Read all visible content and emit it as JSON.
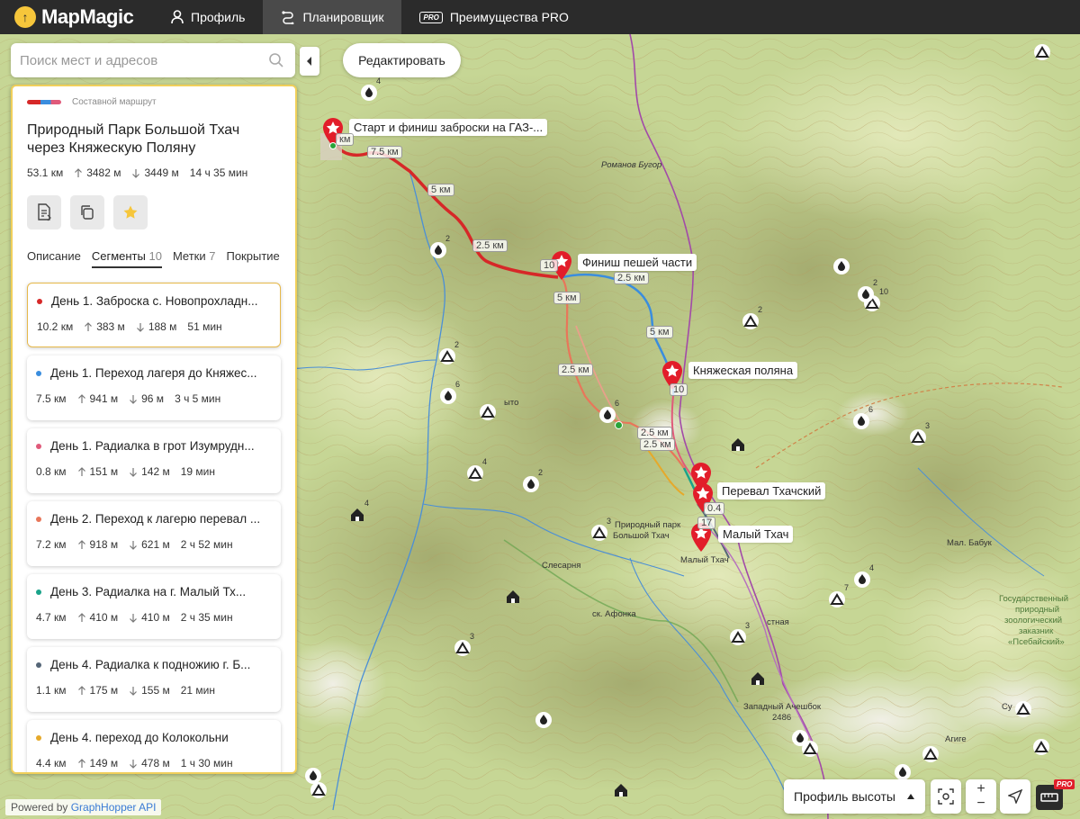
{
  "brand": {
    "name": "MapMagic",
    "mark": "↑"
  },
  "nav": [
    {
      "label": "Профиль",
      "icon": "user-icon"
    },
    {
      "label": "Планировщик",
      "icon": "route-icon"
    },
    {
      "label": "Преимущества PRO",
      "icon": "pro-icon",
      "chip": "PRO"
    }
  ],
  "search": {
    "placeholder": "Поиск мест и адресов",
    "value": ""
  },
  "edit_button": "Редактировать",
  "route": {
    "type_label": "Составной маршрут",
    "title": "Природный Парк Большой Тхач через Княжескую Поляну",
    "distance": "53.1 км",
    "ascent": "3482 м",
    "descent": "3449 м",
    "duration": "14 ч 35 мин"
  },
  "tabs": [
    {
      "label": "Описание",
      "count": ""
    },
    {
      "label": "Сегменты",
      "count": "10"
    },
    {
      "label": "Метки",
      "count": "7"
    },
    {
      "label": "Покрытие",
      "count": ""
    }
  ],
  "segments": [
    {
      "title": "День 1. Заброска с. Новопрохладн...",
      "color": "#d62828",
      "distance": "10.2 км",
      "ascent": "383 м",
      "descent": "188 м",
      "duration": "51 мин"
    },
    {
      "title": "День 1. Переход лагеря до Княжес...",
      "color": "#3a8dde",
      "distance": "7.5 км",
      "ascent": "941 м",
      "descent": "96 м",
      "duration": "3 ч 5 мин"
    },
    {
      "title": "День 1. Радиалка в грот Изумрудн...",
      "color": "#e05a7a",
      "distance": "0.8 км",
      "ascent": "151 м",
      "descent": "142 м",
      "duration": "19 мин"
    },
    {
      "title": "День 2. Переход к лагерю перевал ...",
      "color": "#e8765a",
      "distance": "7.2 км",
      "ascent": "918 м",
      "descent": "621 м",
      "duration": "2 ч 52 мин"
    },
    {
      "title": "День 3. Радиалка на г. Малый Тх...",
      "color": "#1aa38a",
      "distance": "4.7 км",
      "ascent": "410 м",
      "descent": "410 м",
      "duration": "2 ч 35 мин"
    },
    {
      "title": "День 4. Радиалка к подножию г. Б...",
      "color": "#556677",
      "distance": "1.1 км",
      "ascent": "175 м",
      "descent": "155 м",
      "duration": "21 мин"
    },
    {
      "title": "День 4. переход до Колокольни",
      "color": "#e6a92a",
      "distance": "4.4 км",
      "ascent": "149 м",
      "descent": "478 м",
      "duration": "1 ч 30 мин"
    }
  ],
  "map_labels": {
    "start": "Старт и финиш заброски на ГАЗ-...",
    "finish_walk": "Финиш пешей части",
    "knyazheskaya": "Княжеская поляна",
    "pereval": "Перевал Тхачский",
    "maly_tkhach": "Малый Тхач"
  },
  "places": {
    "romanov": "Романов Бугор",
    "park_1": "Природный парк",
    "park_2": "Большой Тхач",
    "slesarnya": "Слесарня",
    "afonka": "ск. Афонка",
    "malyi_tkhach_small": "Малый Тхач",
    "mal_babuk": "Мал. Бабук",
    "zap_acheshbok_1": "Западный Ачешбок",
    "zap_acheshbok_2": "2486",
    "zapovednik_1": "Государственный",
    "zapovednik_2": "природный",
    "zapovednik_3": "зоологический",
    "zapovednik_4": "заказник",
    "zapovednik_5": "«Псебайский»",
    "agige": "Агиге",
    "stnaya": "стная",
    "su": "Су",
    "yto": "ыто"
  },
  "km_tags": {
    "k1": "км",
    "k2": "7.5 км",
    "k3": "5 км",
    "k4": "2.5 км",
    "k5": "10",
    "k6": "2.5 км",
    "k7": "5 км",
    "k8": "5 км",
    "k9": "2.5 км",
    "k10": "2.5 км",
    "k11": "2.5 км",
    "k12": "10",
    "k13": "17",
    "k14": "0.4"
  },
  "markers": {
    "nums": [
      "4",
      "2",
      "6",
      "4",
      "2",
      "3",
      "2",
      "6",
      "2",
      "10",
      "2",
      "3",
      "6",
      "7",
      "4",
      "3",
      "3",
      "4"
    ]
  },
  "bottom": {
    "powered_prefix": "Powered by ",
    "powered_link": "GraphHopper API",
    "elevation_button": "Профиль высоты",
    "pro_badge": "PRO"
  },
  "colors": {
    "topbar": "#2b2b2b",
    "route_red": "#d62828",
    "route_blue": "#3a8dde",
    "route_salmon": "#e8765a",
    "accent_yellow": "#f6c63b",
    "region_border": "#a24aa8"
  }
}
